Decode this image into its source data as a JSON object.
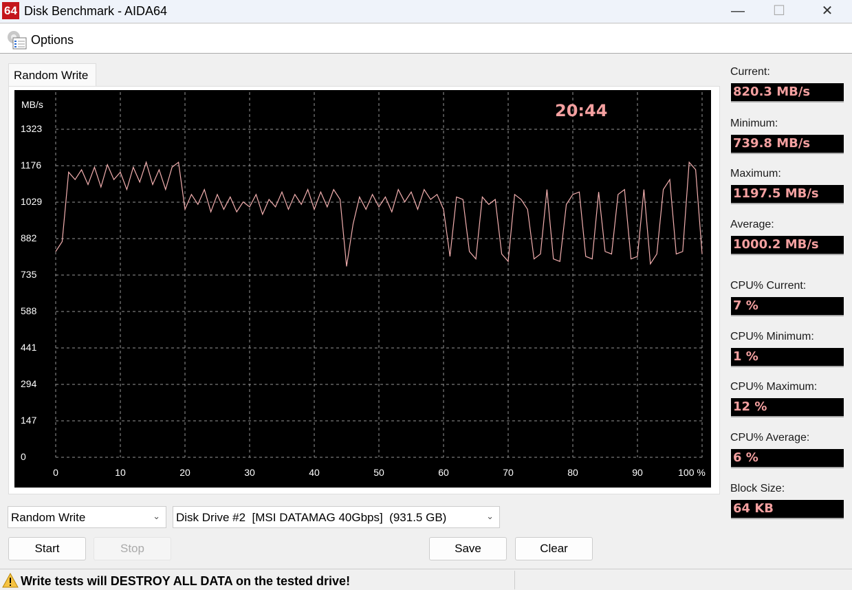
{
  "window": {
    "icon_text": "64",
    "title": "Disk Benchmark - AIDA64"
  },
  "menu": {
    "options_label": "Options"
  },
  "tab": {
    "label": "Random Write"
  },
  "chart_data": {
    "type": "line",
    "title": "",
    "timer": "20:44",
    "ylabel": "MB/s",
    "xlabel": "",
    "ylim": [
      0,
      1323
    ],
    "xlim": [
      0,
      100
    ],
    "yticks": [
      "0",
      "147",
      "294",
      "441",
      "588",
      "735",
      "882",
      "1029",
      "1176",
      "1323"
    ],
    "xticks": [
      "0",
      "10",
      "20",
      "30",
      "40",
      "50",
      "60",
      "70",
      "80",
      "90",
      "100 %"
    ],
    "grid": true,
    "line_color": "#f4b0b0",
    "series": [
      {
        "name": "Random Write",
        "x_step": 1,
        "values": [
          830,
          870,
          1150,
          1120,
          1160,
          1100,
          1170,
          1090,
          1180,
          1120,
          1150,
          1080,
          1170,
          1110,
          1190,
          1100,
          1160,
          1080,
          1170,
          1190,
          1000,
          1060,
          1020,
          1080,
          990,
          1060,
          1000,
          1050,
          990,
          1030,
          1010,
          1060,
          980,
          1040,
          1010,
          1070,
          1000,
          1060,
          1020,
          1080,
          1000,
          1070,
          1010,
          1080,
          1040,
          770,
          940,
          1050,
          1000,
          1060,
          1010,
          1050,
          990,
          1080,
          1030,
          1070,
          1000,
          1080,
          1040,
          1060,
          1000,
          810,
          1050,
          1040,
          830,
          800,
          1050,
          1020,
          1040,
          820,
          790,
          1060,
          1040,
          1000,
          800,
          820,
          1080,
          800,
          790,
          1020,
          1060,
          1070,
          810,
          800,
          1070,
          830,
          820,
          1060,
          1080,
          800,
          810,
          1080,
          780,
          820,
          1080,
          1120,
          820,
          830,
          1190,
          1160,
          820
        ]
      }
    ]
  },
  "stats": [
    {
      "label": "Current:",
      "value": "820.3 MB/s"
    },
    {
      "label": "Minimum:",
      "value": "739.8 MB/s"
    },
    {
      "label": "Maximum:",
      "value": "1197.5 MB/s"
    },
    {
      "label": "Average:",
      "value": "1000.2 MB/s"
    },
    {
      "label": "CPU% Current:",
      "value": "7 %"
    },
    {
      "label": "CPU% Minimum:",
      "value": "1 %"
    },
    {
      "label": "CPU% Maximum:",
      "value": "12 %"
    },
    {
      "label": "CPU% Average:",
      "value": "6 %"
    },
    {
      "label": "Block Size:",
      "value": "64 KB"
    }
  ],
  "controls": {
    "test_select": "Random Write",
    "drive_select": "Disk Drive #2  [MSI DATAMAG 40Gbps]  (931.5 GB)",
    "start": "Start",
    "stop": "Stop",
    "save": "Save",
    "clear": "Clear"
  },
  "status": {
    "warning": "Write tests will DESTROY ALL DATA on the tested drive!"
  }
}
